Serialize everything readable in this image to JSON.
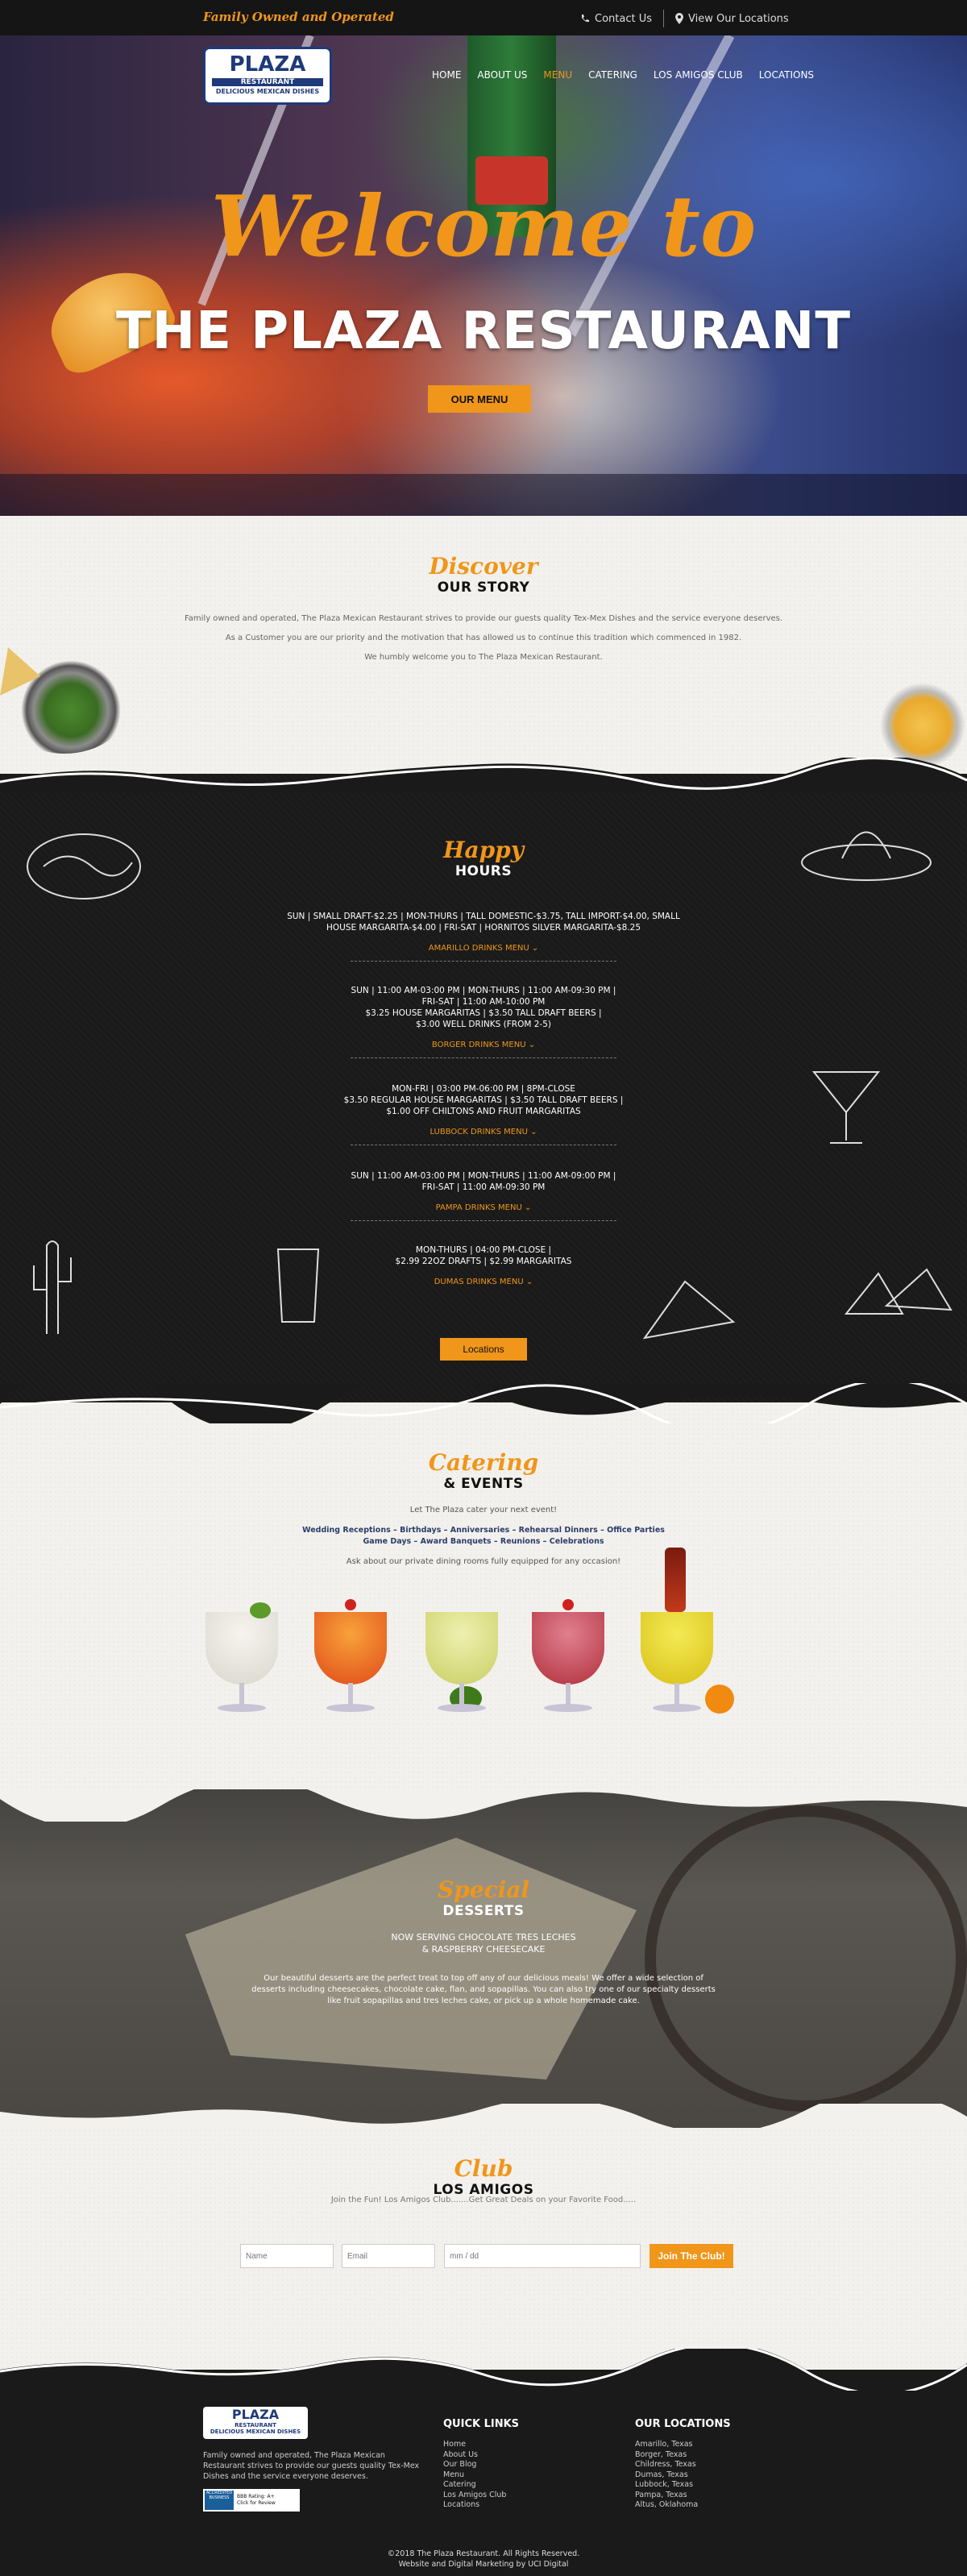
{
  "topbar": {
    "tagline": "Family Owned and Operated",
    "contact": "Contact Us",
    "locations": "View Our Locations"
  },
  "logo": {
    "line1": "PLAZA",
    "line2": "RESTAURANT",
    "line3": "DELICIOUS MEXICAN DISHES"
  },
  "nav": [
    "HOME",
    "ABOUT US",
    "MENU",
    "CATERING",
    "LOS AMIGOS CLUB",
    "LOCATIONS"
  ],
  "hero": {
    "script": "Welcome to",
    "title": "THE PLAZA RESTAURANT",
    "button": "OUR MENU"
  },
  "story": {
    "script": "Discover",
    "heading": "OUR STORY",
    "p1": "Family owned and operated, The Plaza Mexican Restaurant strives to provide our guests quality Tex-Mex Dishes and the service everyone deserves.",
    "p2": "As a Customer you are our priority and the motivation that has allowed us to continue this tradition which commenced in 1982.",
    "p3": "We humbly welcome you to The Plaza Mexican Restaurant."
  },
  "hours": {
    "script": "Happy",
    "heading": "HOURS",
    "locations": [
      {
        "text": [
          "SUN | SMALL DRAFT-$2.25 | MON-THURS | TALL DOMESTIC-$3.75, TALL IMPORT-$4.00, SMALL",
          "HOUSE MARGARITA-$4.00 | FRI-SAT | HORNITOS SILVER MARGARITA-$8.25"
        ],
        "link": "AMARILLO DRINKS MENU"
      },
      {
        "text": [
          "SUN | 11:00 AM-03:00 PM | MON-THURS | 11:00 AM-09:30 PM |",
          "FRI-SAT | 11:00 AM-10:00 PM",
          "$3.25 HOUSE MARGARITAS | $3.50 TALL DRAFT BEERS |",
          "$3.00 WELL DRINKS (FROM 2-5)"
        ],
        "link": "BORGER DRINKS MENU"
      },
      {
        "text": [
          "MON-FRI | 03:00 PM-06:00 PM | 8PM-CLOSE",
          "$3.50 REGULAR HOUSE MARGARITAS | $3.50 TALL DRAFT BEERS |",
          "$1.00 OFF CHILTONS AND FRUIT MARGARITAS"
        ],
        "link": "LUBBOCK DRINKS MENU"
      },
      {
        "text": [
          "SUN | 11:00 AM-03:00 PM | MON-THURS | 11:00 AM-09:00 PM |",
          "FRI-SAT | 11:00 AM-09:30 PM"
        ],
        "link": "PAMPA DRINKS MENU"
      },
      {
        "text": [
          "MON-THURS | 04:00 PM-CLOSE |",
          "$2.99 22OZ DRAFTS | $2.99 MARGARITAS"
        ],
        "link": "DUMAS DRINKS MENU"
      }
    ],
    "button": "Locations"
  },
  "catering": {
    "script": "Catering",
    "heading": "& EVENTS",
    "line1": "Let The Plaza cater your next event!",
    "line2": "Wedding Receptions – Birthdays – Anniversaries – Rehearsal Dinners – Office Parties Game Days – Award Banquets – Reunions – Celebrations",
    "line3": "Ask about our private dining rooms fully equipped for any occasion!"
  },
  "desserts": {
    "script": "Special",
    "heading": "DESSERTS",
    "sub1": "NOW SERVING CHOCOLATE TRES LECHES",
    "sub2": "& RASPBERRY CHEESECAKE",
    "body": "Our beautiful desserts are the perfect treat to top off any of our delicious meals! We offer a wide selection of desserts including cheesecakes, chocolate cake, flan, and sopapillas. You can also try one of our specialty desserts like fruit sopapillas and tres leches cake, or pick up a whole homemade cake."
  },
  "club": {
    "script": "Club",
    "heading": "LOS AMIGOS",
    "sub": "Join the Fun! Los Amigos Club.......Get Great Deals on your Favorite Food.....",
    "name_placeholder": "Name",
    "email_placeholder": "Email",
    "date_placeholder": "mm / dd",
    "button": "Join The Club!"
  },
  "footer": {
    "logo1": "PLAZA",
    "logo2": "RESTAURANT",
    "logo3": "DELICIOUS MEXICAN DISHES",
    "desc": "Family owned and operated, The Plaza Mexican Restaurant strives to provide our guests quality Tex-Mex Dishes and the service everyone deserves.",
    "bbb_seal": "ACCREDITED BUSINESS",
    "bbb_rating": "BBB Rating: A+",
    "bbb_click": "Click for Review",
    "quick_title": "QUICK LINKS",
    "quick_links": [
      "Home",
      "About Us",
      "Our Blog",
      "Menu",
      "Catering",
      "Los Amigos Club",
      "Locations"
    ],
    "loc_title": "OUR LOCATIONS",
    "locations": [
      "Amarillo, Texas",
      "Borger, Texas",
      "Childress, Texas",
      "Dumas, Texas",
      "Lubbock, Texas",
      "Pampa, Texas",
      "Altus, Oklahoma"
    ],
    "copyright": "©2018 The Plaza Restaurant. All Rights Reserved.",
    "credit": "Website and Digital Marketing by UCI Digital"
  }
}
